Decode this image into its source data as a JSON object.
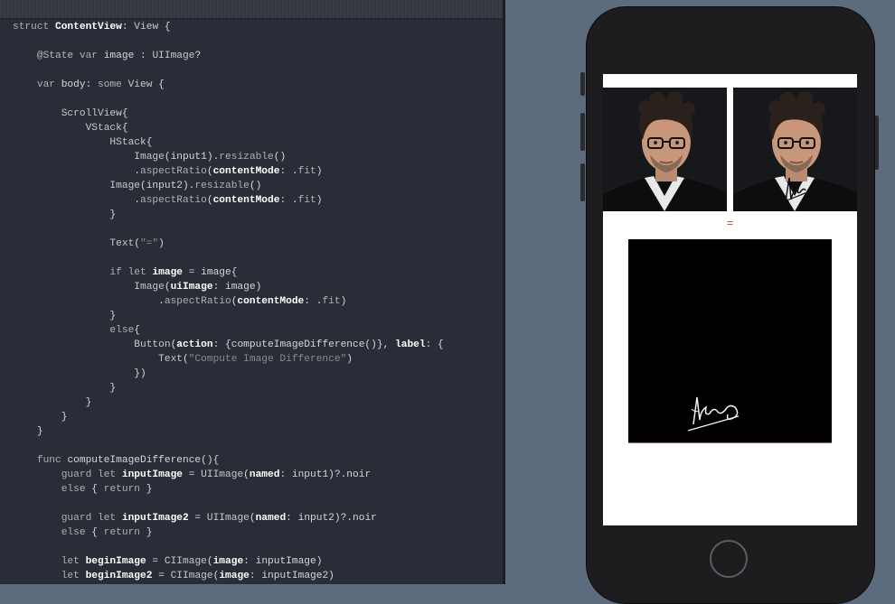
{
  "code_lines": [
    [
      [
        "kw",
        "struct "
      ],
      [
        "bold",
        "ContentView"
      ],
      [
        "",
        ": "
      ],
      [
        "ty",
        "View"
      ],
      [
        "",
        " {"
      ]
    ],
    [],
    [
      [
        "",
        "    "
      ],
      [
        "attr",
        "@State "
      ],
      [
        "kw",
        "var "
      ],
      [
        "",
        "image : "
      ],
      [
        "ty",
        "UIImage"
      ],
      [
        "",
        "?"
      ]
    ],
    [],
    [
      [
        "",
        "    "
      ],
      [
        "kw",
        "var "
      ],
      [
        "",
        "body: "
      ],
      [
        "kw",
        "some "
      ],
      [
        "ty",
        "View"
      ],
      [
        "",
        " {"
      ]
    ],
    [],
    [
      [
        "",
        "        "
      ],
      [
        "ty",
        "ScrollView"
      ],
      [
        "",
        "{"
      ]
    ],
    [
      [
        "",
        "            "
      ],
      [
        "ty",
        "VStack"
      ],
      [
        "",
        "{"
      ]
    ],
    [
      [
        "",
        "                "
      ],
      [
        "ty",
        "HStack"
      ],
      [
        "",
        "{"
      ]
    ],
    [
      [
        "",
        "                    "
      ],
      [
        "ty",
        "Image"
      ],
      [
        "",
        "(input1)."
      ],
      [
        "kw",
        "resizable"
      ],
      [
        "",
        "()"
      ]
    ],
    [
      [
        "",
        "                    ."
      ],
      [
        "kw",
        "aspectRatio"
      ],
      [
        "",
        "("
      ],
      [
        "bold",
        "contentMode"
      ],
      [
        "",
        ": ."
      ],
      [
        "kw",
        "fit"
      ],
      [
        "",
        ")"
      ]
    ],
    [
      [
        "",
        "                "
      ],
      [
        "ty",
        "Image"
      ],
      [
        "",
        "(input2)."
      ],
      [
        "kw",
        "resizable"
      ],
      [
        "",
        "()"
      ]
    ],
    [
      [
        "",
        "                    ."
      ],
      [
        "kw",
        "aspectRatio"
      ],
      [
        "",
        "("
      ],
      [
        "bold",
        "contentMode"
      ],
      [
        "",
        ": ."
      ],
      [
        "kw",
        "fit"
      ],
      [
        "",
        ")"
      ]
    ],
    [
      [
        "",
        "                }"
      ]
    ],
    [],
    [
      [
        "",
        "                "
      ],
      [
        "ty",
        "Text"
      ],
      [
        "",
        "("
      ],
      [
        "str",
        "\"=\""
      ],
      [
        "",
        ")"
      ]
    ],
    [],
    [
      [
        "",
        "                "
      ],
      [
        "kw",
        "if let "
      ],
      [
        "bold",
        "image"
      ],
      [
        "",
        " = image{"
      ]
    ],
    [
      [
        "",
        "                    "
      ],
      [
        "ty",
        "Image"
      ],
      [
        "",
        "("
      ],
      [
        "bold",
        "uiImage"
      ],
      [
        "",
        ": image)"
      ]
    ],
    [
      [
        "",
        "                        ."
      ],
      [
        "kw",
        "aspectRatio"
      ],
      [
        "",
        "("
      ],
      [
        "bold",
        "contentMode"
      ],
      [
        "",
        ": ."
      ],
      [
        "kw",
        "fit"
      ],
      [
        "",
        ")"
      ]
    ],
    [
      [
        "",
        "                }"
      ]
    ],
    [
      [
        "",
        "                "
      ],
      [
        "kw",
        "else"
      ],
      [
        "",
        "{"
      ]
    ],
    [
      [
        "",
        "                    "
      ],
      [
        "ty",
        "Button"
      ],
      [
        "",
        "("
      ],
      [
        "bold",
        "action"
      ],
      [
        "",
        ": {computeImageDifference()}, "
      ],
      [
        "bold",
        "label"
      ],
      [
        "",
        ": {"
      ]
    ],
    [
      [
        "",
        "                        "
      ],
      [
        "ty",
        "Text"
      ],
      [
        "",
        "("
      ],
      [
        "str",
        "\"Compute Image Difference\""
      ],
      [
        "",
        ")"
      ]
    ],
    [
      [
        "",
        "                    })"
      ]
    ],
    [
      [
        "",
        "                }"
      ]
    ],
    [
      [
        "",
        "            }"
      ]
    ],
    [
      [
        "",
        "        }"
      ]
    ],
    [
      [
        "",
        "    }"
      ]
    ],
    [],
    [
      [
        "",
        "    "
      ],
      [
        "kw",
        "func "
      ],
      [
        "",
        "computeImageDifference(){"
      ]
    ],
    [
      [
        "",
        "        "
      ],
      [
        "kw",
        "guard let "
      ],
      [
        "bold",
        "inputImage"
      ],
      [
        "",
        " = "
      ],
      [
        "ty",
        "UIImage"
      ],
      [
        "",
        "("
      ],
      [
        "bold",
        "named"
      ],
      [
        "",
        ": input1)?.noir"
      ]
    ],
    [
      [
        "",
        "        "
      ],
      [
        "kw",
        "else"
      ],
      [
        "",
        " { "
      ],
      [
        "kw",
        "return"
      ],
      [
        "",
        " }"
      ]
    ],
    [],
    [
      [
        "",
        "        "
      ],
      [
        "kw",
        "guard let "
      ],
      [
        "bold",
        "inputImage2"
      ],
      [
        "",
        " = "
      ],
      [
        "ty",
        "UIImage"
      ],
      [
        "",
        "("
      ],
      [
        "bold",
        "named"
      ],
      [
        "",
        ": input2)?.noir"
      ]
    ],
    [
      [
        "",
        "        "
      ],
      [
        "kw",
        "else"
      ],
      [
        "",
        " { "
      ],
      [
        "kw",
        "return"
      ],
      [
        "",
        " }"
      ]
    ],
    [],
    [
      [
        "",
        "        "
      ],
      [
        "kw",
        "let "
      ],
      [
        "bold",
        "beginImage"
      ],
      [
        "",
        " = "
      ],
      [
        "ty",
        "CIImage"
      ],
      [
        "",
        "("
      ],
      [
        "bold",
        "image"
      ],
      [
        "",
        ": inputImage)"
      ]
    ],
    [
      [
        "",
        "        "
      ],
      [
        "kw",
        "let "
      ],
      [
        "bold",
        "beginImage2"
      ],
      [
        "",
        " = "
      ],
      [
        "ty",
        "CIImage"
      ],
      [
        "",
        "("
      ],
      [
        "bold",
        "image"
      ],
      [
        "",
        ": inputImage2)"
      ]
    ]
  ],
  "simulator": {
    "equals_text": "=",
    "portrait_left": "portrait-image",
    "portrait_right": "portrait-image-with-signature",
    "difference_image": "signature-difference-image"
  },
  "colors": {
    "editor_bg": "#2a2d37",
    "sim_bg": "#5d6b7e",
    "equals": "#c0392b"
  }
}
